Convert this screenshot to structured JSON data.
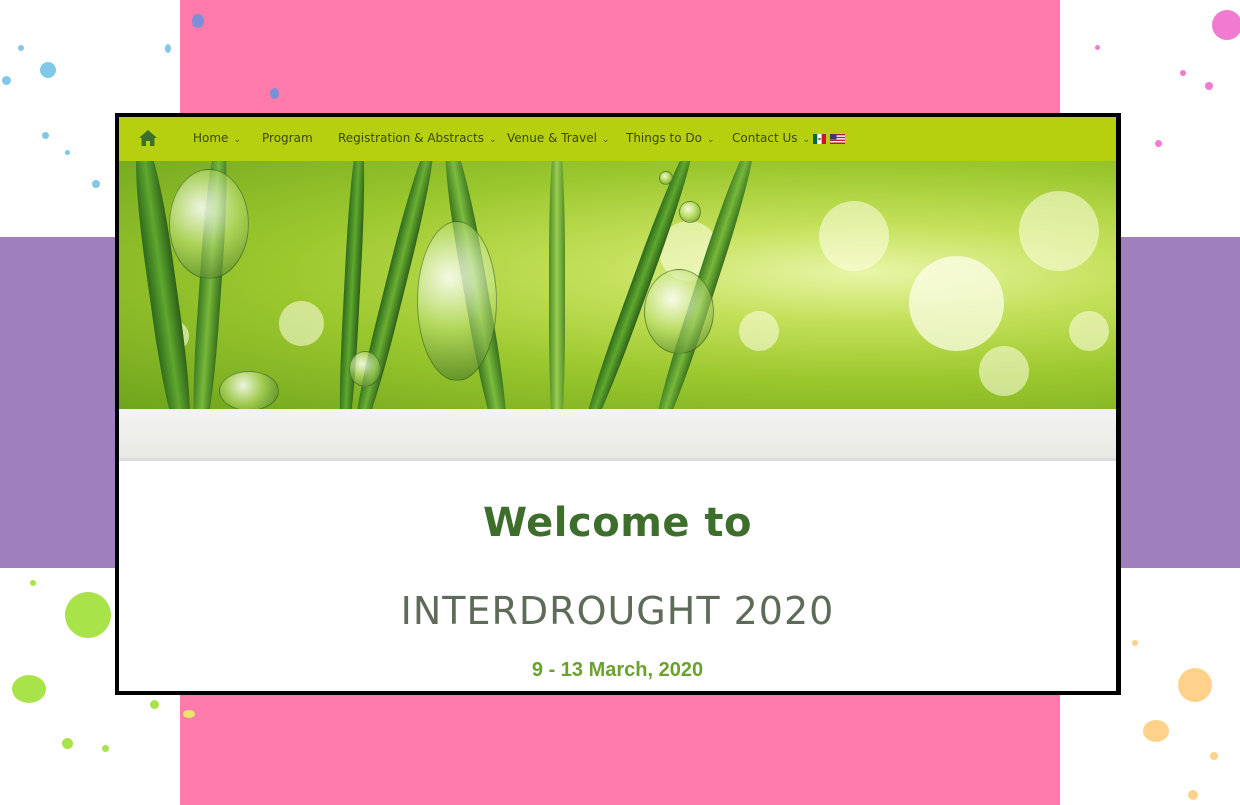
{
  "nav": {
    "home_icon": "home-icon",
    "items": [
      {
        "label": "Home",
        "dropdown": true
      },
      {
        "label": "Program",
        "dropdown": false
      },
      {
        "label": "Registration & Abstracts",
        "dropdown": true
      },
      {
        "label": "Venue & Travel",
        "dropdown": true
      },
      {
        "label": "Things to Do",
        "dropdown": true
      },
      {
        "label": "Contact Us",
        "dropdown": true
      }
    ],
    "flags": [
      "mexico-flag-icon",
      "usa-flag-icon"
    ]
  },
  "main": {
    "welcome": "Welcome to",
    "event_name": "INTERDROUGHT 2020",
    "dates": "9 - 13 March, 2020"
  },
  "colors": {
    "nav_bg": "#b6cf0e",
    "welcome_text": "#3e6e2c",
    "dates_text": "#6aa22e",
    "backdrop_pink": "#ff7bab",
    "backdrop_purple": "#a07fbe"
  }
}
